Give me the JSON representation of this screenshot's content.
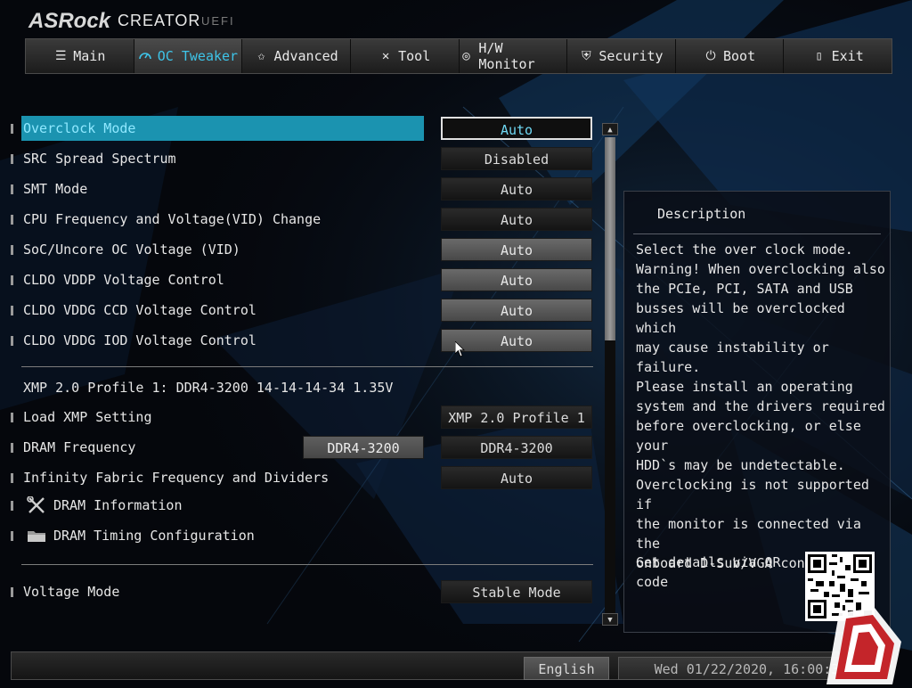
{
  "brand": {
    "name": "ASRock",
    "product": "CREATOR",
    "suffix": "UEFI"
  },
  "tabs": [
    {
      "label": "Main",
      "icon": "list-icon"
    },
    {
      "label": "OC Tweaker",
      "icon": "speedometer-icon",
      "active": true
    },
    {
      "label": "Advanced",
      "icon": "star-icon"
    },
    {
      "label": "Tool",
      "icon": "tools-icon"
    },
    {
      "label": "H/W Monitor",
      "icon": "monitor-icon"
    },
    {
      "label": "Security",
      "icon": "shield-icon"
    },
    {
      "label": "Boot",
      "icon": "power-icon"
    },
    {
      "label": "Exit",
      "icon": "exit-door-icon"
    }
  ],
  "settings": [
    {
      "label": "Overclock Mode",
      "value": "Auto"
    },
    {
      "label": "SRC Spread Spectrum",
      "value": "Disabled"
    },
    {
      "label": "SMT Mode",
      "value": "Auto"
    },
    {
      "label": "CPU Frequency and Voltage(VID) Change",
      "value": "Auto"
    },
    {
      "label": "SoC/Uncore OC Voltage (VID)",
      "value": "Auto"
    },
    {
      "label": "CLDO VDDP Voltage Control",
      "value": "Auto"
    },
    {
      "label": "CLDO VDDG CCD Voltage Control",
      "value": "Auto"
    },
    {
      "label": "CLDO VDDG IOD Voltage Control",
      "value": "Auto"
    }
  ],
  "xmp_info": "XMP 2.0 Profile 1: DDR4-3200 14-14-14-34 1.35V",
  "memory": [
    {
      "label": "Load XMP Setting",
      "value": "XMP 2.0 Profile 1"
    },
    {
      "label": "DRAM Frequency",
      "current": "DDR4-3200",
      "value": "DDR4-3200"
    },
    {
      "label": "Infinity Fabric Frequency and Dividers",
      "value": "Auto"
    }
  ],
  "submenus": [
    {
      "label": "DRAM Information",
      "icon": "tools-icon"
    },
    {
      "label": "DRAM Timing Configuration",
      "icon": "folder-icon"
    }
  ],
  "voltage": {
    "label": "Voltage Mode",
    "value": "Stable Mode"
  },
  "description": {
    "title": "Description",
    "text": "Select the over clock mode.\nWarning! When overclocking also\nthe PCIe, PCI, SATA and USB\nbusses will be overclocked which\nmay cause instability or failure.\nPlease install an operating\nsystem and the drivers required\nbefore overclocking, or else your\nHDD`s may be undetectable.\nOverclocking is not supported if\nthe monitor is connected via the\nonboard D-Sub/VGA connector.",
    "qr_text": "Get details via QR code"
  },
  "footer": {
    "language": "English",
    "datetime": "Wed 01/22/2020, 16:00:38"
  },
  "colors": {
    "accent": "#1b93b0",
    "accent_text": "#3ec4e8",
    "background": "#05070c"
  }
}
